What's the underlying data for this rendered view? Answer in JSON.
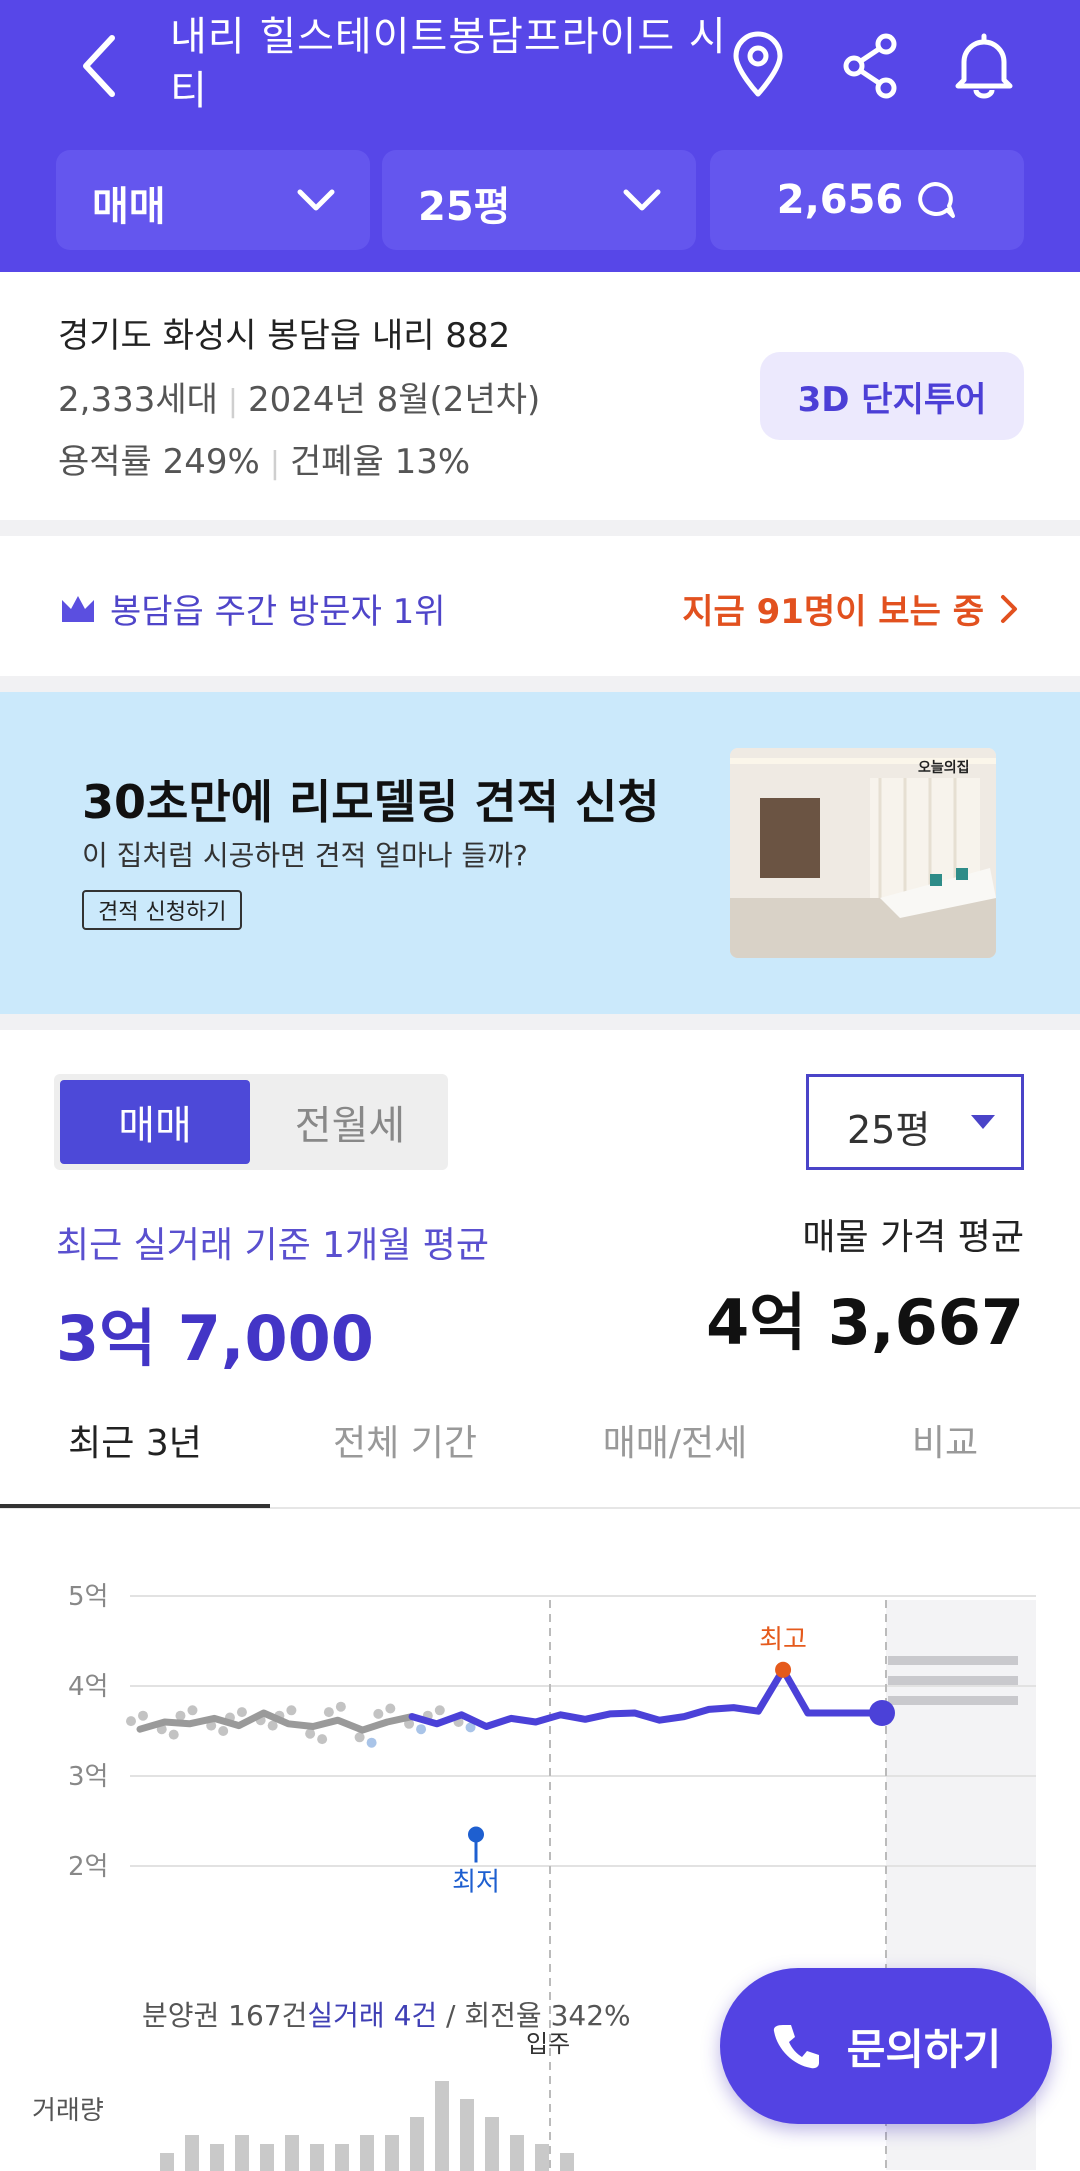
{
  "header": {
    "title": "내리 힐스테이트봉담프라이드 시티",
    "trade_type": "매매",
    "size": "25평",
    "comments": "2,656"
  },
  "info": {
    "address": "경기도 화성시 봉담읍 내리 882",
    "households": "2,333세대",
    "built": "2024년 8월(2년차)",
    "far": "용적률 249%",
    "bcr": "건폐율 13%",
    "tour_button": "3D 단지투어"
  },
  "ranking": {
    "text": "봉담읍 주간 방문자 1위",
    "viewers": "지금 91명이 보는 중"
  },
  "banner": {
    "title": "30초만에 리모델링 견적 신청",
    "subtitle": "이 집처럼 시공하면 견적 얼마나 들까?",
    "button": "견적 신청하기",
    "brand": "오늘의집"
  },
  "price": {
    "seg_sale": "매매",
    "seg_rent": "전월세",
    "size_select": "25평",
    "recent_label": "최근 실거래 기준 1개월 평균",
    "recent_value": "3억 7,000",
    "listing_label": "매물 가격 평균",
    "listing_value": "4억 3,667"
  },
  "tabs": [
    "최근 3년",
    "전체 기간",
    "매매/전세",
    "비교"
  ],
  "chart_data": {
    "type": "line",
    "yticks": [
      "5억",
      "4억",
      "3억",
      "2억"
    ],
    "ylim": [
      2,
      5
    ],
    "unit": "억",
    "markers": {
      "high": "최고",
      "low": "최저",
      "move_in": "입주"
    },
    "series": [
      {
        "values": [
          3.52,
          3.6,
          3.58,
          3.64,
          3.56,
          3.7,
          3.58,
          3.55,
          3.62,
          3.51,
          3.6,
          3.66,
          3.58,
          3.68,
          3.55,
          3.64,
          3.6,
          3.68,
          3.63,
          3.69,
          3.7,
          3.62,
          3.66,
          3.74,
          3.76,
          3.72,
          4.18,
          3.7,
          3.7,
          3.7,
          3.7
        ]
      }
    ],
    "high_value": 4.18,
    "low_value": 2.35,
    "last_value": 3.7,
    "volume": [
      2,
      4,
      3,
      4,
      3,
      4,
      3,
      3,
      4,
      4,
      6,
      10,
      8,
      6,
      4,
      3,
      2
    ]
  },
  "stats": {
    "presale": "분양권 167건",
    "trades": "실거래 4건",
    "slash": " / ",
    "turnover": "회전율 342%"
  },
  "volume_label": "거래량",
  "cta": "문의하기"
}
